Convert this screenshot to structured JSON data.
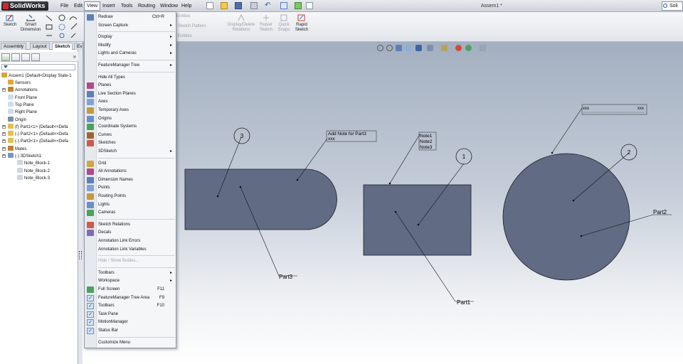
{
  "app": {
    "name": "SolidWorks",
    "document_title": "Assem1 *",
    "search_text": "Soli"
  },
  "menubar": {
    "items": [
      "File",
      "Edit",
      "View",
      "Insert",
      "Tools",
      "Routing",
      "Window",
      "Help"
    ],
    "active": "View"
  },
  "command_manager": {
    "left": [
      {
        "label1": "Sketch",
        "label2": ""
      },
      {
        "label1": "Smart",
        "label2": "Dimension"
      }
    ],
    "right": [
      {
        "label1": "Entities",
        "label2": "",
        "dim": true
      },
      {
        "label1": "Sketch Pattern",
        "label2": "",
        "dim": true
      },
      {
        "label1": "Entities",
        "label2": "",
        "dim": true
      },
      {
        "label1": "Display/Delete",
        "label2": "Relations",
        "dim": true
      },
      {
        "label1": "Repair",
        "label2": "Sketch",
        "dim": true
      },
      {
        "label1": "Quick",
        "label2": "Snaps",
        "dim": true
      },
      {
        "label1": "Rapid",
        "label2": "Sketch",
        "dim": false
      }
    ]
  },
  "command_tabs": [
    "Assembly",
    "Layout",
    "Sketch",
    "Ev"
  ],
  "command_tab_active": "Sketch",
  "tree": {
    "root": "Assem1  (Default<Display State-1",
    "items": [
      {
        "label": "Sensors",
        "indent": 1,
        "icon": "sensor-icon",
        "expand": false
      },
      {
        "label": "Annotations",
        "indent": 1,
        "icon": "annotations-icon",
        "expand": true
      },
      {
        "label": "Front Plane",
        "indent": 1,
        "icon": "plane-icon",
        "expand": false
      },
      {
        "label": "Top Plane",
        "indent": 1,
        "icon": "plane-icon",
        "expand": false
      },
      {
        "label": "Right Plane",
        "indent": 1,
        "icon": "plane-icon",
        "expand": false
      },
      {
        "label": "Origin",
        "indent": 1,
        "icon": "origin-icon",
        "expand": false
      },
      {
        "label": "(f) Part1<1> (Default<<Defa",
        "indent": 1,
        "icon": "part-icon",
        "expand": true
      },
      {
        "label": "(-) Part2<1> (Default<<Defa",
        "indent": 1,
        "icon": "part-icon",
        "expand": true
      },
      {
        "label": "(-) Part3<1> (Default<<Defa",
        "indent": 1,
        "icon": "part-icon",
        "expand": true
      },
      {
        "label": "Mates",
        "indent": 1,
        "icon": "mates-icon",
        "expand": true
      },
      {
        "label": "(-) 3DSketch1",
        "indent": 1,
        "icon": "sketch-icon",
        "expand": true
      },
      {
        "label": "Note_Block-1",
        "indent": 2,
        "icon": "note-icon",
        "expand": false
      },
      {
        "label": "Note_Block-2",
        "indent": 2,
        "icon": "note-icon",
        "expand": false
      },
      {
        "label": "Note_Block-3",
        "indent": 2,
        "icon": "note-icon",
        "expand": false
      }
    ]
  },
  "view_menu": {
    "items": [
      {
        "label": "Redraw",
        "shortcut": "Ctrl+R",
        "icon": "redraw-icon"
      },
      {
        "label": "Screen Capture",
        "submenu": true
      },
      {
        "sep": true
      },
      {
        "label": "Display",
        "submenu": true
      },
      {
        "label": "Modify",
        "submenu": true
      },
      {
        "label": "Lights and Cameras",
        "submenu": true
      },
      {
        "sep": true
      },
      {
        "label": "FeatureManager Tree",
        "submenu": true
      },
      {
        "sep": true
      },
      {
        "label": "Hide All Types"
      },
      {
        "label": "Planes",
        "icon": "planes-icon"
      },
      {
        "label": "Live Section Planes",
        "icon": "live-section-icon"
      },
      {
        "label": "Axes",
        "icon": "axes-icon"
      },
      {
        "label": "Temporary Axes",
        "icon": "temp-axes-icon"
      },
      {
        "label": "Origins",
        "icon": "origins-icon"
      },
      {
        "label": "Coordinate Systems",
        "icon": "coord-sys-icon"
      },
      {
        "label": "Curves",
        "icon": "curves-icon"
      },
      {
        "label": "Sketches",
        "icon": "sketches-icon"
      },
      {
        "label": "3DSketch",
        "submenu": true
      },
      {
        "sep": true
      },
      {
        "label": "Grid",
        "icon": "grid-icon"
      },
      {
        "label": "All Annotations",
        "icon": "all-annotations-icon"
      },
      {
        "label": "Dimension Names",
        "icon": "dimension-names-icon"
      },
      {
        "label": "Points",
        "icon": "points-icon"
      },
      {
        "label": "Routing Points",
        "icon": "routing-points-icon"
      },
      {
        "label": "Lights",
        "icon": "lights-icon"
      },
      {
        "label": "Cameras",
        "icon": "cameras-icon"
      },
      {
        "sep": true
      },
      {
        "label": "Sketch Relations",
        "icon": "sketch-relations-icon"
      },
      {
        "label": "Decals",
        "icon": "decals-icon"
      },
      {
        "label": "Annotation Link Errors"
      },
      {
        "label": "Annotation Link Variables"
      },
      {
        "sep": true
      },
      {
        "label": "Hide / Show Bodies...",
        "disabled": true
      },
      {
        "sep": true
      },
      {
        "label": "Toolbars",
        "submenu": true
      },
      {
        "label": "Workspace",
        "submenu": true
      },
      {
        "label": "Full Screen",
        "shortcut": "F11",
        "icon": "full-screen-icon"
      },
      {
        "label": "FeatureManager Tree Area",
        "shortcut": "F9",
        "checked": true
      },
      {
        "label": "Toolbars",
        "shortcut": "F10",
        "checked": true
      },
      {
        "label": "Task Pane",
        "checked": true
      },
      {
        "label": "MotionManager",
        "checked": true
      },
      {
        "label": "Status Bar",
        "checked": true
      },
      {
        "sep": true
      },
      {
        "label": "Customize Menu"
      }
    ]
  },
  "drawing": {
    "balloons": [
      "3",
      "1",
      "2"
    ],
    "notes": {
      "part3_note": [
        "Add Note for Part3",
        "xxx"
      ],
      "stack_note": [
        "Note1",
        "Note2",
        "Note3"
      ],
      "circle_note": [
        "xxx",
        "xxx"
      ]
    },
    "labels": [
      "Part3",
      "Part1",
      "Part2"
    ]
  }
}
